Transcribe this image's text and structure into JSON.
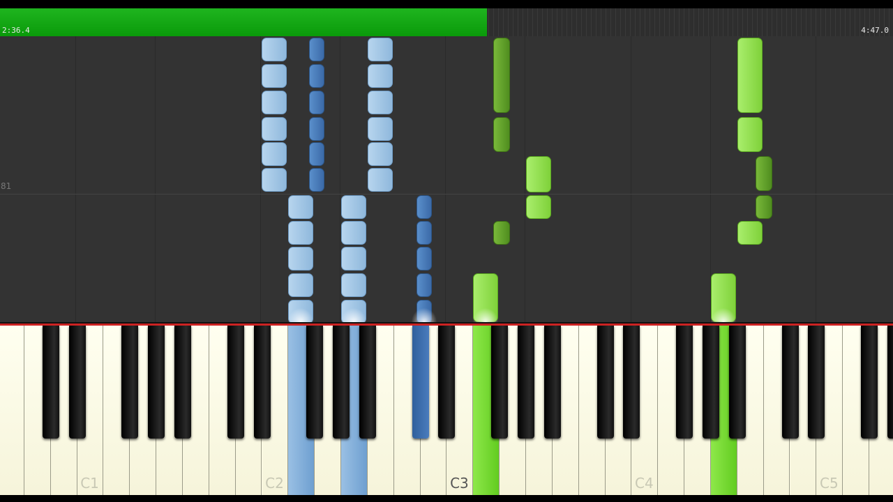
{
  "playback": {
    "elapsed": "2:36.4",
    "total": "4:47.0",
    "progress_fraction": 0.545
  },
  "roll": {
    "measure_number": "81"
  },
  "keyboard": {
    "octave_labels": [
      "C1",
      "C2",
      "C3",
      "C4",
      "C5"
    ]
  },
  "colors": {
    "left_hand": "#8fb8dc",
    "left_hand_dark": "#3b6aa8",
    "right_hand": "#7fd13a",
    "right_hand_dark": "#4f8d1f",
    "hit_line": "#cc2222"
  }
}
